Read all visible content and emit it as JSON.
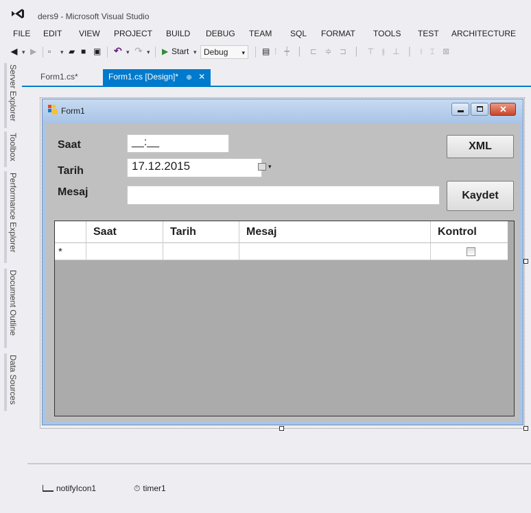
{
  "window": {
    "title": "ders9 - Microsoft Visual Studio"
  },
  "menu": [
    "FILE",
    "EDIT",
    "VIEW",
    "PROJECT",
    "BUILD",
    "DEBUG",
    "TEAM",
    "SQL",
    "FORMAT",
    "TOOLS",
    "TEST",
    "ARCHITECTURE"
  ],
  "toolbar": {
    "start_label": "Start",
    "config_value": "Debug"
  },
  "left_tabs": [
    "Server Explorer",
    "Toolbox",
    "Performance Explorer",
    "Document Outline",
    "Data Sources"
  ],
  "doc_tabs": {
    "code_tab": "Form1.cs*",
    "design_tab": "Form1.cs [Design]*",
    "pin_glyph": "⊕",
    "close_glyph": "✕"
  },
  "form": {
    "title": "Form1",
    "saat_label": "Saat",
    "tarih_label": "Tarih",
    "mesaj_label": "Mesaj",
    "saat_value": "__:__",
    "tarih_value": "17.12.2015",
    "mesaj_value": "",
    "xml_button": "XML",
    "kaydet_button": "Kaydet"
  },
  "grid": {
    "columns": [
      "Saat",
      "Tarih",
      "Mesaj",
      "Kontrol"
    ],
    "new_row_glyph": "*"
  },
  "tray": [
    "notifyIcon1",
    "timer1"
  ],
  "colors": {
    "accent": "#007acc",
    "form_border": "#a9c5e6",
    "grid_bg": "#ababab"
  }
}
